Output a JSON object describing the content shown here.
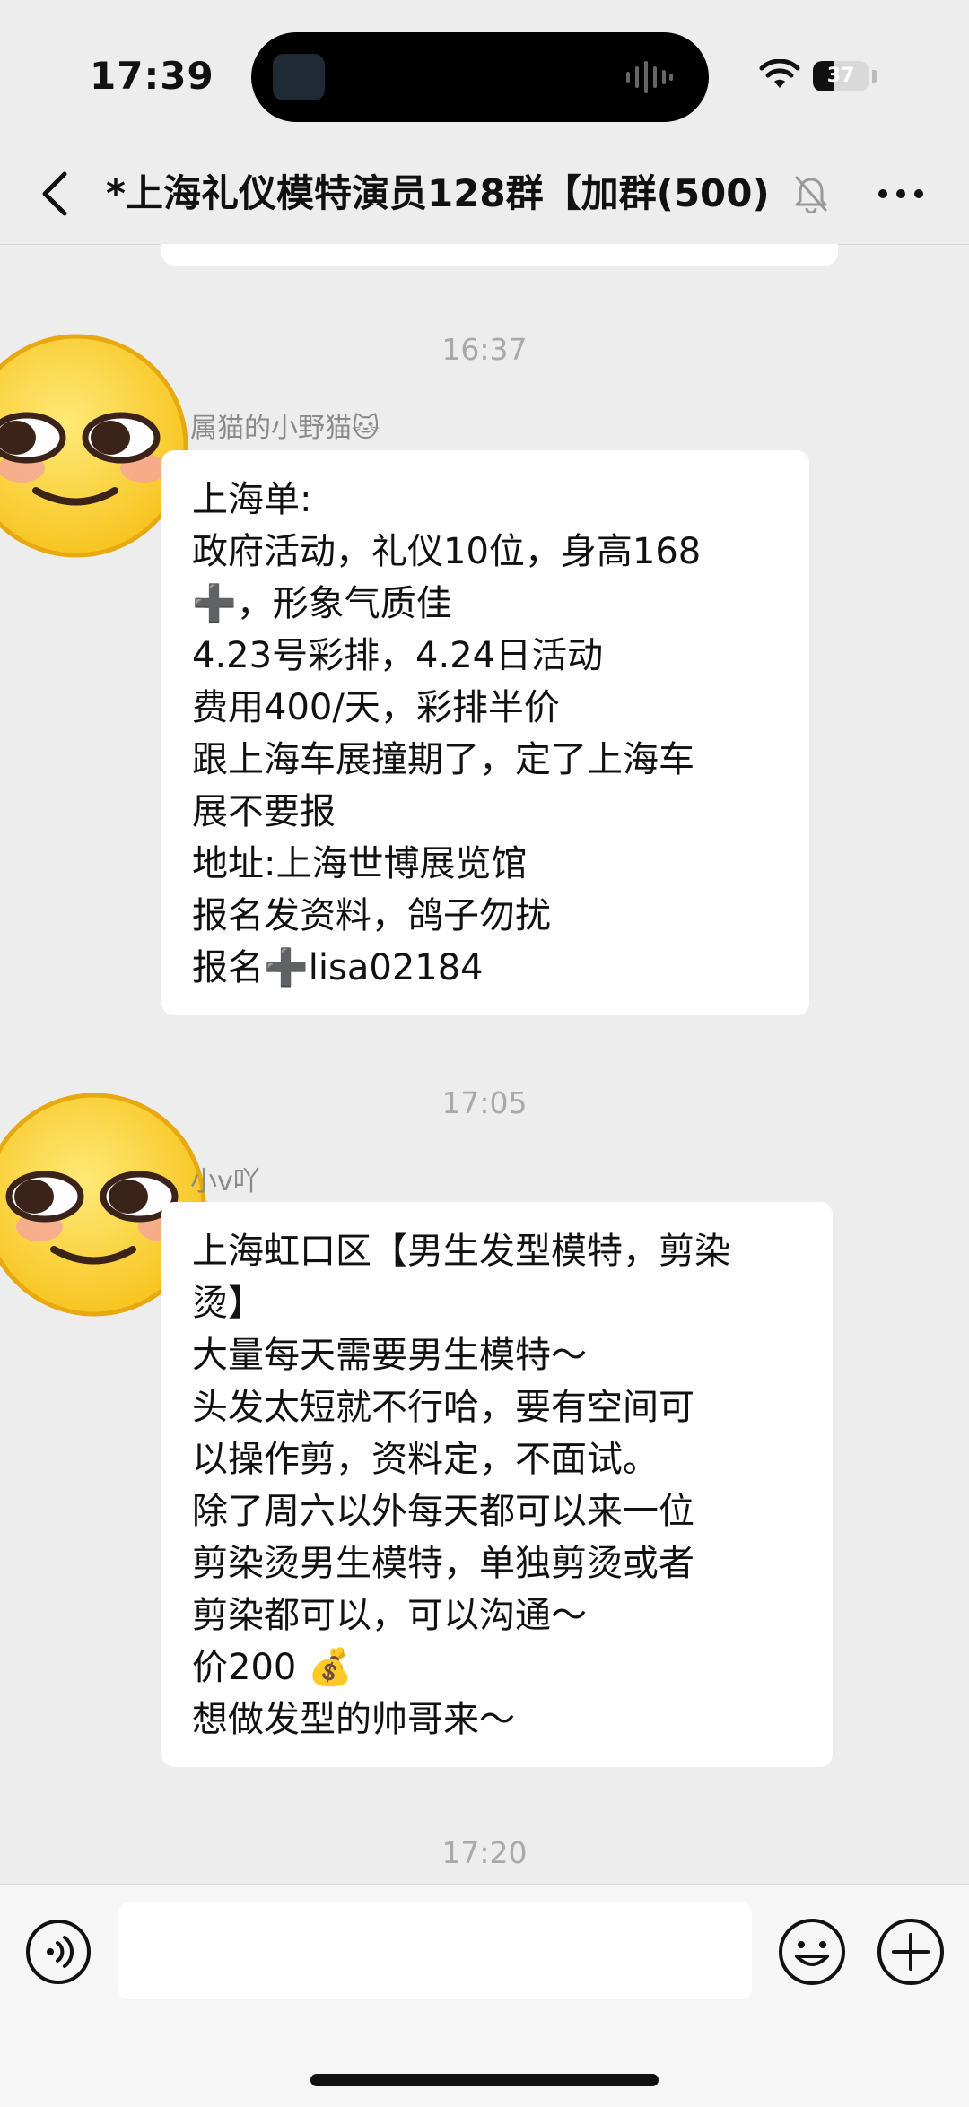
{
  "status": {
    "time": "17:39",
    "battery": "37",
    "battery_level": 0.37
  },
  "nav": {
    "title": "*上海礼仪模特演员128群【加群(500)",
    "icons": [
      "back-icon",
      "mute-icon",
      "more-icon"
    ]
  },
  "messages": [
    {
      "time": "16:37",
      "sender": "属猫的小野猫🐱",
      "lines": [
        "上海单:",
        "政府活动，礼仪10位，身高168",
        "➕，形象气质佳",
        "4.23号彩排，4.24日活动",
        "费用400/天，彩排半价",
        "跟上海车展撞期了，定了上海车",
        "展不要报",
        "地址:上海世博展览馆",
        "报名发资料，鸽子勿扰",
        "报名➕lisa02184"
      ]
    },
    {
      "time": "17:05",
      "sender": "小v吖",
      "lines": [
        "上海虹口区【男生发型模特，剪染",
        "烫】",
        "大量每天需要男生模特～",
        "头发太短就不行哈，要有空间可",
        "以操作剪，资料定，不面试。",
        "除了周六以外每天都可以来一位",
        "剪染烫男生模特，单独剪烫或者",
        "剪染都可以，可以沟通～",
        "价200 💰",
        "想做发型的帅哥来～"
      ]
    }
  ],
  "last_time": "17:20",
  "input": {
    "value": "",
    "icons": [
      "voice-icon",
      "emoji-icon",
      "plus-icon"
    ]
  },
  "colors": {
    "background": "#ededed",
    "bubble": "#ffffff",
    "timestamp": "#a9a9a9",
    "sender": "#8a8a8a"
  }
}
